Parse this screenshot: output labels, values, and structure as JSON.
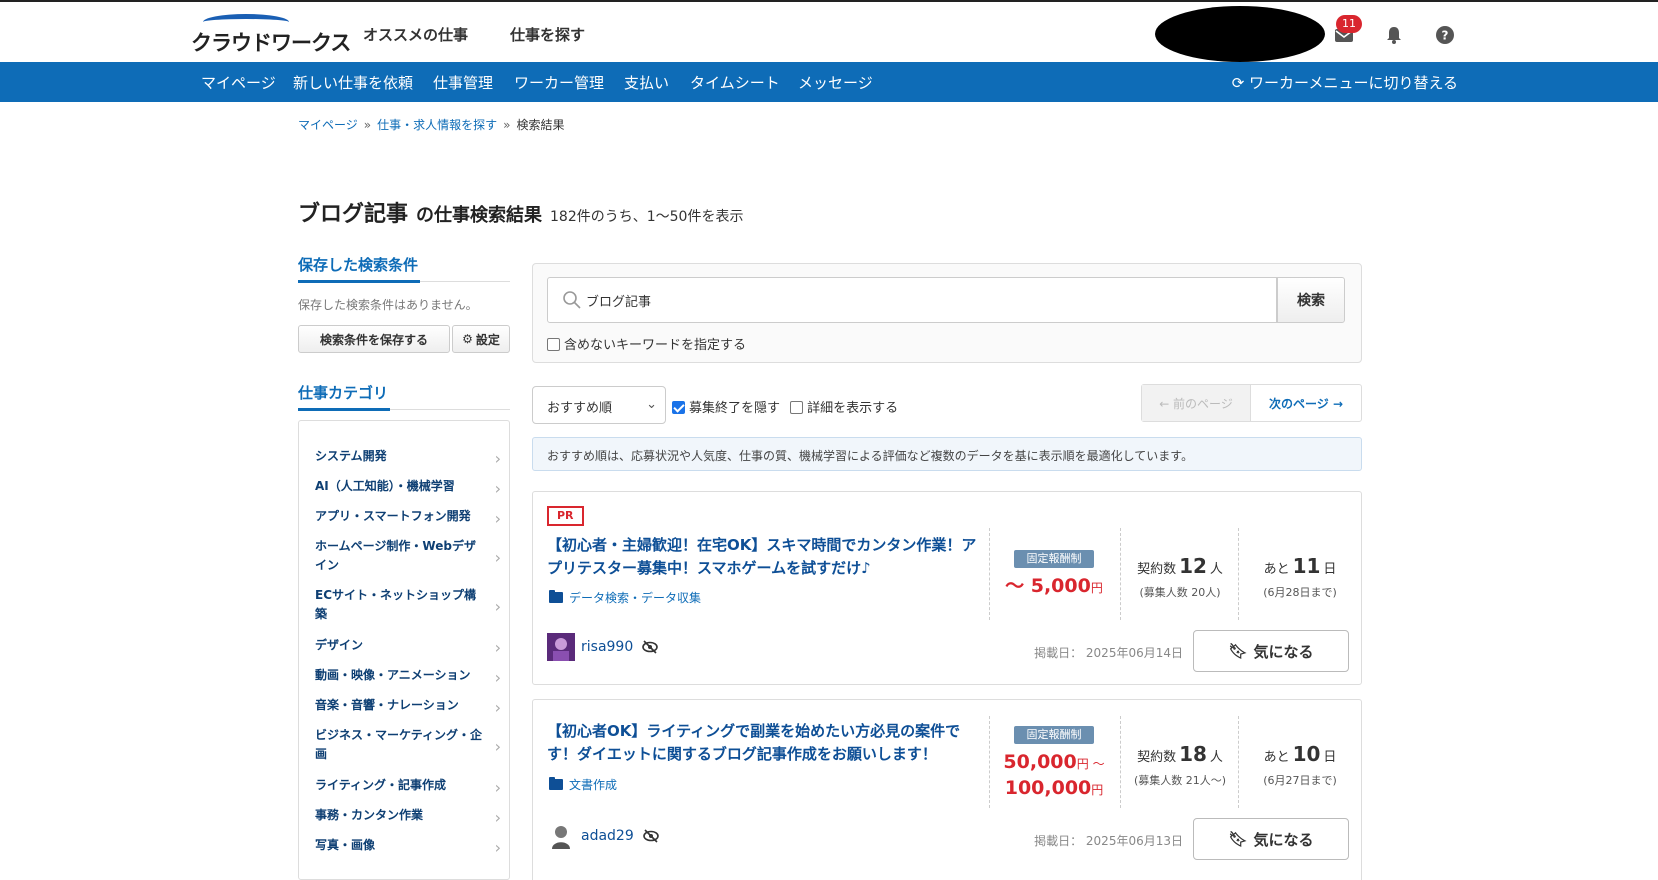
{
  "header": {
    "logo_text": "クラウドワークス",
    "nav": [
      "オススメの仕事",
      "仕事を探す"
    ],
    "message_badge": "11"
  },
  "bluebar": {
    "items": [
      "マイページ",
      "新しい仕事を依頼",
      "仕事管理",
      "ワーカー管理",
      "支払い",
      "タイムシート",
      "メッセージ"
    ],
    "switch_label": "ワーカーメニューに切り替える"
  },
  "breadcrumb": [
    "マイページ",
    "仕事・求人情報を探す",
    "検索結果"
  ],
  "title": {
    "keyword": "ブログ記事",
    "suffix": "の仕事検索結果",
    "count": "182件のうち、1〜50件を表示"
  },
  "sidebar": {
    "saved_heading": "保存した検索条件",
    "saved_empty": "保存した検索条件はありません。",
    "save_button": "検索条件を保存する",
    "settings_button": "設定",
    "category_heading": "仕事カテゴリ",
    "categories": [
      "システム開発",
      "AI（人工知能）・機械学習",
      "アプリ・スマートフォン開発",
      "ホームページ制作・Webデザイン",
      "ECサイト・ネットショップ構築",
      "デザイン",
      "動画・映像・アニメーション",
      "音楽・音響・ナレーション",
      "ビジネス・マーケティング・企画",
      "ライティング・記事作成",
      "事務・カンタン作業",
      "写真・画像"
    ]
  },
  "search": {
    "value": "ブログ記事",
    "button": "検索",
    "exclude_label": "含めないキーワードを指定する"
  },
  "toolbar": {
    "sort_value": "おすすめ順",
    "hide_closed": "募集終了を隠す",
    "show_details": "詳細を表示する",
    "prev": "← 前のページ",
    "next": "次のページ →"
  },
  "notice": "おすすめ順は、応募状況や人気度、仕事の質、機械学習による評価など複数のデータを基に表示順を最適化しています。",
  "jobs": [
    {
      "pr": "PR",
      "title": "【初心者・主婦歓迎！在宅OK】スキマ時間でカンタン作業！アプリテスター募集中！スマホゲームを試すだけ♪",
      "category": "データ検索・データ収集",
      "pay_type": "固定報酬制",
      "price_line1": "～ 5,000",
      "price_unit1": "円",
      "contracts_label": "契約数",
      "contracts": "12",
      "contracts_unit": "人",
      "recruit": "(募集人数 20人)",
      "remain_label": "あと",
      "remain_days": "11",
      "remain_unit": "日",
      "deadline": "(6月28日まで)",
      "user": "risa990",
      "posted": "掲載日： 2025年06月14日",
      "fav": "気になる"
    },
    {
      "title": "【初心者OK】ライティングで副業を始めたい方必見の案件です！ダイエットに関するブログ記事作成をお願いします！",
      "category": "文書作成",
      "pay_type": "固定報酬制",
      "price_line1": "50,000",
      "price_unit1": "円 ～",
      "price_line2": "100,000",
      "price_unit2": "円",
      "contracts_label": "契約数",
      "contracts": "18",
      "contracts_unit": "人",
      "recruit": "(募集人数 21人〜)",
      "remain_label": "あと",
      "remain_days": "10",
      "remain_unit": "日",
      "deadline": "(6月27日まで)",
      "user": "adad29",
      "posted": "掲載日： 2025年06月13日",
      "fav": "気になる"
    }
  ],
  "colors": {
    "brand_blue": "#0e6cb7",
    "price_red": "#d9262e",
    "badge_red": "#d9262e"
  }
}
